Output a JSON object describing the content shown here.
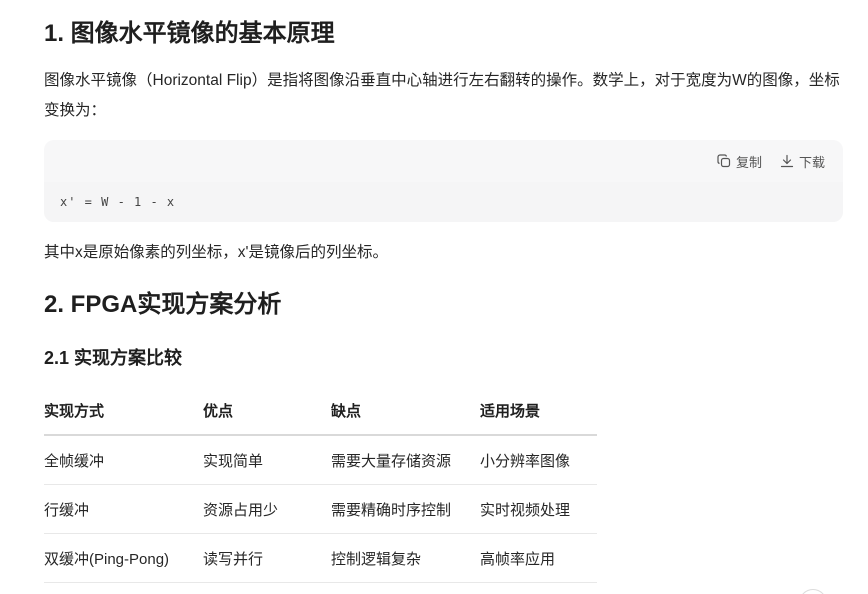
{
  "section1": {
    "title": "1. 图像水平镜像的基本原理",
    "paragraph": "图像水平镜像（Horizontal Flip）是指将图像沿垂直中心轴进行左右翻转的操作。数学上，对于宽度为W的图像，坐标变换为：",
    "code_block": {
      "copy_label": "复制",
      "download_label": "下载",
      "code": "x' = W - 1 - x"
    },
    "note": "其中x是原始像素的列坐标，x'是镜像后的列坐标。"
  },
  "section2": {
    "title": "2. FPGA实现方案分析",
    "subsection": {
      "title": "2.1 实现方案比较",
      "table": {
        "headers": [
          "实现方式",
          "优点",
          "缺点",
          "适用场景"
        ],
        "rows": [
          [
            "全帧缓冲",
            "实现简单",
            "需要大量存储资源",
            "小分辨率图像"
          ],
          [
            "行缓冲",
            "资源占用少",
            "需要精确时序控制",
            "实时视频处理"
          ],
          [
            "双缓冲(Ping-Pong)",
            "读写并行",
            "控制逻辑复杂",
            "高帧率应用"
          ]
        ]
      }
    }
  }
}
